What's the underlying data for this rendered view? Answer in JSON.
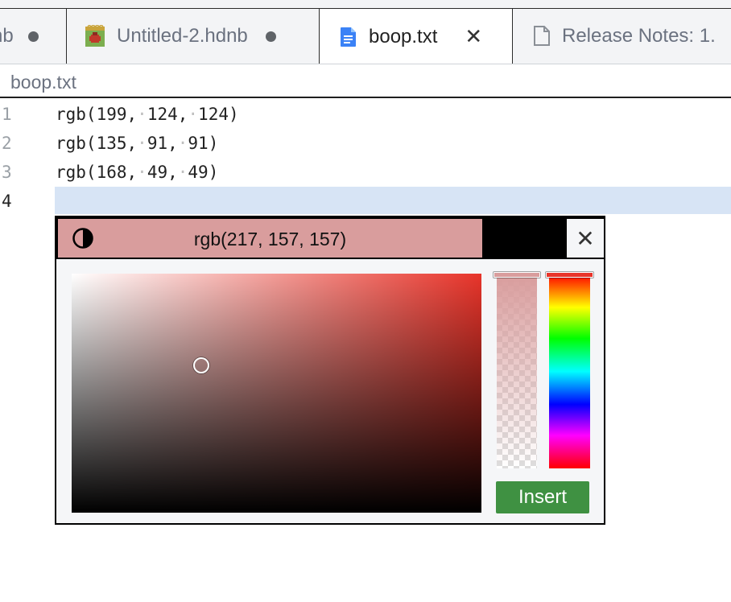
{
  "tabs": [
    {
      "label": "nb",
      "modified": true,
      "active": false,
      "icon": "notebook-icon"
    },
    {
      "label": "Untitled-2.hdnb",
      "modified": true,
      "active": false,
      "icon": "notebook-app-icon"
    },
    {
      "label": "boop.txt",
      "modified": false,
      "active": true,
      "icon": "text-file-icon"
    },
    {
      "label": "Release Notes: 1.",
      "modified": false,
      "active": false,
      "icon": "document-icon"
    }
  ],
  "breadcrumb": "boop.txt",
  "editor": {
    "lines": [
      {
        "number": "1",
        "parts": [
          "rgb(199,",
          "124,",
          "124)"
        ]
      },
      {
        "number": "2",
        "parts": [
          "rgb(135,",
          "91,",
          "91)"
        ]
      },
      {
        "number": "3",
        "parts": [
          "rgb(168,",
          "49,",
          "49)"
        ]
      },
      {
        "number": "4",
        "parts": []
      }
    ]
  },
  "color_picker": {
    "value_label": "rgb(217, 157, 157)",
    "preview_color": "#d99d9d",
    "insert_label": "Insert",
    "insert_color": "#3f9142",
    "hue_color": "#e8342a"
  }
}
